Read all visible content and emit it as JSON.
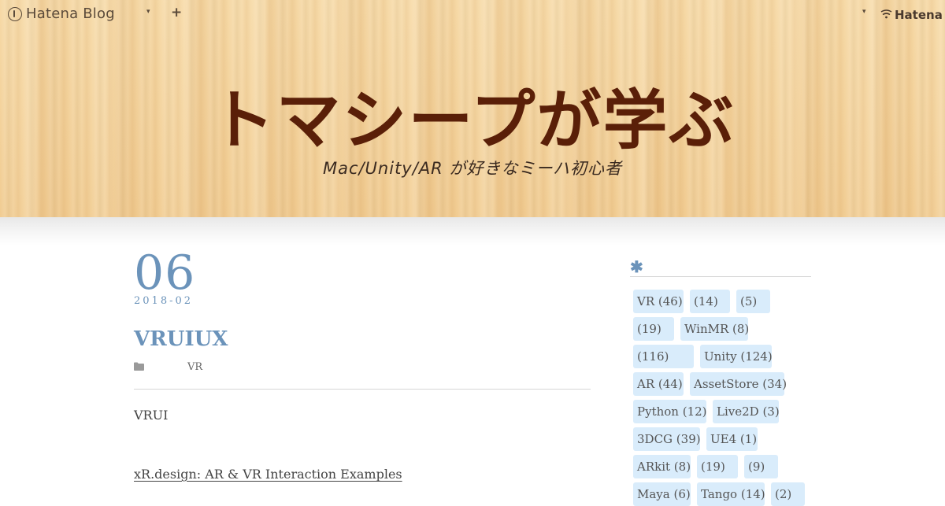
{
  "global_header": {
    "logo_text": "Hatena Blog",
    "menu_caret": "▾",
    "add_label": "+",
    "user_caret": "▾",
    "hatena_text": "Hatena"
  },
  "blog": {
    "title": "トマシープが学ぶ",
    "description": "Mac/Unity/AR が好きなミーハ初心者"
  },
  "entry": {
    "date_day": "06",
    "date_year_month": "2018-02",
    "title": "VRUIUX",
    "category": "VR",
    "paragraph": "VRUI",
    "link_text": "xR.design: AR & VR Interaction Examples"
  },
  "sidebar": {
    "heading_icon": "✱",
    "tags": [
      {
        "label": "VR (46)"
      },
      {
        "label": "(14)"
      },
      {
        "label": "(5)"
      },
      {
        "label": "(19)"
      },
      {
        "label": "WinMR (8)"
      },
      {
        "label": "(116)"
      },
      {
        "label": "Unity (124)"
      },
      {
        "label": "AR (44)"
      },
      {
        "label": "AssetStore (34)"
      },
      {
        "label": "Python (12)"
      },
      {
        "label": "Live2D (3)"
      },
      {
        "label": "3DCG (39)"
      },
      {
        "label": "UE4 (1)"
      },
      {
        "label": "ARkit (8)"
      },
      {
        "label": "(19)"
      },
      {
        "label": "(9)"
      },
      {
        "label": "Maya (6)"
      },
      {
        "label": "Tango (14)"
      },
      {
        "label": "(2)"
      }
    ]
  },
  "icons": {
    "logo": "hatena-blog-logo-icon",
    "category": "folder-icon",
    "hatena": "hatena-mark-icon"
  }
}
